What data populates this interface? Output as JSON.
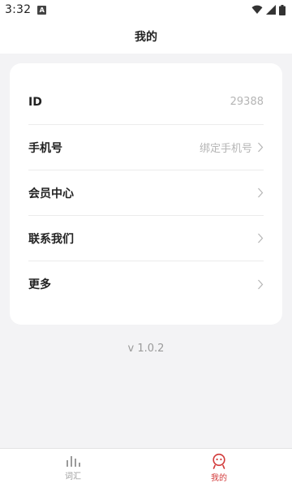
{
  "status_bar": {
    "time": "3:32",
    "app_icon_letter": "A"
  },
  "header": {
    "title": "我的"
  },
  "profile_rows": [
    {
      "label": "ID",
      "value": "29388",
      "has_chevron": false
    },
    {
      "label": "手机号",
      "value": "绑定手机号",
      "has_chevron": true
    },
    {
      "label": "会员中心",
      "value": "",
      "has_chevron": true
    },
    {
      "label": "联系我们",
      "value": "",
      "has_chevron": true
    },
    {
      "label": "更多",
      "value": "",
      "has_chevron": true
    }
  ],
  "version": "v 1.0.2",
  "tabs": [
    {
      "label": "词汇",
      "icon": "bar-chart-icon",
      "active": false
    },
    {
      "label": "我的",
      "icon": "profile-face-icon",
      "active": true
    }
  ],
  "colors": {
    "accent": "#d23a3a",
    "background": "#f3f3f5",
    "card": "#ffffff",
    "muted": "#b5b5b5"
  }
}
